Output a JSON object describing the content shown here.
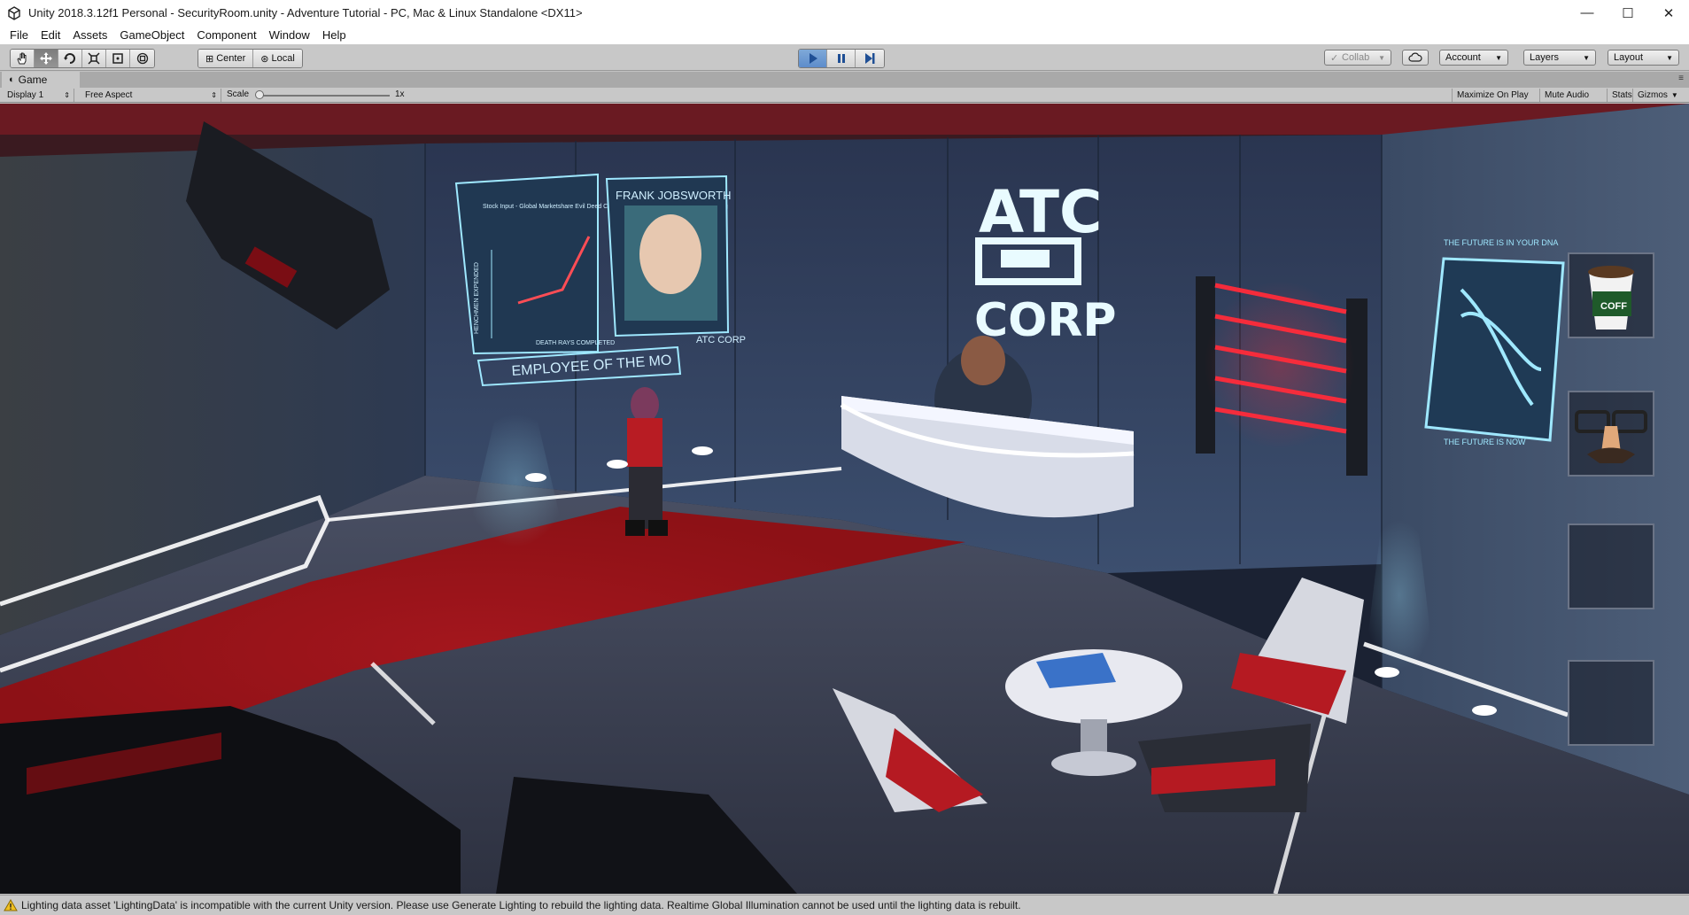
{
  "window": {
    "title": "Unity 2018.3.12f1 Personal - SecurityRoom.unity - Adventure Tutorial - PC, Mac & Linux Standalone <DX11>",
    "controls": {
      "minimize": "—",
      "maximize": "☐",
      "close": "✕"
    }
  },
  "menu": {
    "items": [
      "File",
      "Edit",
      "Assets",
      "GameObject",
      "Component",
      "Window",
      "Help"
    ]
  },
  "toolbar": {
    "tools": [
      "hand-icon",
      "move-icon",
      "rotate-icon",
      "scale-icon",
      "rect-icon",
      "transform-icon"
    ],
    "pivot_center": "Center",
    "pivot_local": "Local",
    "collab": "Collab",
    "account": "Account",
    "layers": "Layers",
    "layout": "Layout"
  },
  "game_tab": {
    "label": "Game",
    "display": "Display 1",
    "aspect": "Free Aspect",
    "scale_label": "Scale",
    "scale_value": "1x",
    "maximize_on_play": "Maximize On Play",
    "mute_audio": "Mute Audio",
    "stats": "Stats",
    "gizmos": "Gizmos"
  },
  "scene": {
    "poster_chart_title": "Stock Input - Global Marketshare Evil Deed Count increase per annum Totally mean thing",
    "poster_chart_ylabel": "HENCHMEN EXPENDED",
    "poster_chart_xlabel": "DEATH RAYS COMPLETED",
    "employee_name": "FRANK JOBSWORTH",
    "employee_banner": "EMPLOYEE OF THE MO",
    "small_logo": "ATC CORP",
    "logo_top": "ATC",
    "logo_bottom": "CORP",
    "dna_top": "THE FUTURE IS IN YOUR DNA",
    "dna_bottom": "THE FUTURE IS NOW",
    "coffee_label": "COFF"
  },
  "inventory": {
    "slots": [
      "coffee-cup-icon",
      "disguise-glasses-icon",
      "",
      ""
    ]
  },
  "status": {
    "message": "Lighting data asset 'LightingData' is incompatible with the current Unity version. Please use Generate Lighting to rebuild the lighting data.  Realtime Global Illumination cannot be used until the lighting data is rebuilt."
  },
  "colors": {
    "accent_play": "#5d8ccb",
    "neon_red": "#ff2b3a",
    "neon_cyan": "#9fe8ff"
  }
}
